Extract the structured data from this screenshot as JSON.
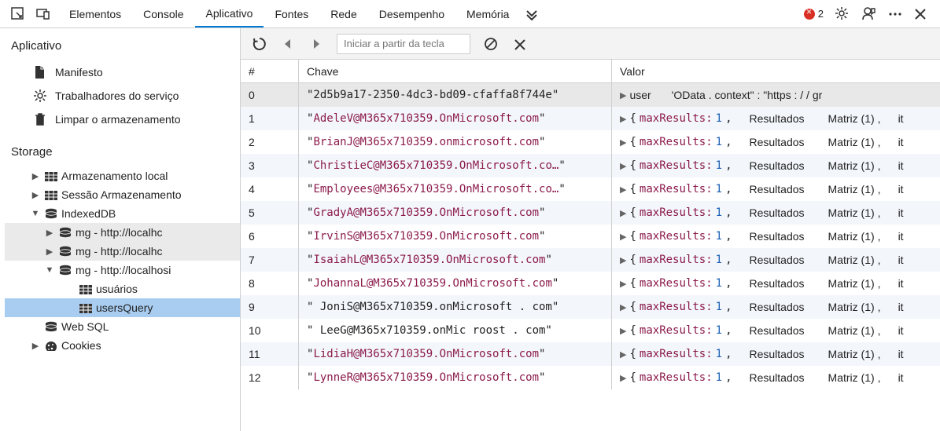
{
  "topbar": {
    "tabs": [
      "Elementos",
      "Console",
      "Aplicativo",
      "Fontes",
      "Rede",
      "Desempenho",
      "Memória"
    ],
    "active_index": 2,
    "error_count": "2"
  },
  "sidebar": {
    "section_app": "Aplicativo",
    "app_items": [
      {
        "icon": "file",
        "label": "Manifesto"
      },
      {
        "icon": "gear",
        "label": "Trabalhadores do serviço"
      },
      {
        "icon": "trash",
        "label": "Limpar o armazenamento"
      }
    ],
    "section_storage": "Storage",
    "storage_tree": [
      {
        "indent": 1,
        "twist": "▶",
        "icon": "table",
        "label": "Armazenamento local"
      },
      {
        "indent": 1,
        "twist": "▶",
        "icon": "table",
        "label": "Sessão Armazenamento"
      },
      {
        "indent": 1,
        "twist": "▼",
        "icon": "db",
        "label": "IndexedDB"
      },
      {
        "indent": 2,
        "twist": "▶",
        "icon": "db",
        "label": "mg - http://localhc",
        "shaded": true
      },
      {
        "indent": 2,
        "twist": "▶",
        "icon": "db",
        "label": "mg - http://localhc",
        "shaded": true
      },
      {
        "indent": 2,
        "twist": "▼",
        "icon": "db",
        "label": "mg - http://localhosi"
      },
      {
        "indent": 3,
        "twist": "",
        "icon": "table",
        "label": "usuários"
      },
      {
        "indent": 3,
        "twist": "",
        "icon": "table",
        "label": "usersQuery",
        "selected": true
      },
      {
        "indent": 1,
        "twist": "",
        "icon": "db",
        "label": "Web SQL"
      },
      {
        "indent": 1,
        "twist": "▶",
        "icon": "cookie",
        "label": "Cookies"
      }
    ]
  },
  "toolbar": {
    "filter_placeholder": "Iniciar a partir da tecla"
  },
  "table": {
    "headers": {
      "idx": "#",
      "key": "Chave",
      "val": "Valor"
    },
    "rows": [
      {
        "idx": "0",
        "key_plain": "\"2d5b9a17-2350-4dc3-bd09-cfaffa8f744e\"",
        "val_type": "header",
        "val_text_a": "user",
        "val_text_b": "'OData . context\" : \"https : / / gr"
      },
      {
        "idx": "1",
        "key_em": "AdeleV@M365x710359.OnMicrosoft.com",
        "val_type": "obj"
      },
      {
        "idx": "2",
        "key_em": "BrianJ@M365x710359.onmicrosoft.com",
        "val_type": "obj"
      },
      {
        "idx": "3",
        "key_em": "ChristieC@M365x710359.OnMicrosoft.co…",
        "val_type": "obj"
      },
      {
        "idx": "4",
        "key_em": "Employees@M365x710359.OnMicrosoft.co…",
        "val_type": "obj"
      },
      {
        "idx": "5",
        "key_em": "GradyA@M365x710359.OnMicrosoft.com",
        "val_type": "obj"
      },
      {
        "idx": "6",
        "key_em": "IrvinS@M365x710359.OnMicrosoft.com",
        "val_type": "obj"
      },
      {
        "idx": "7",
        "key_em": "IsaiahL@M365x710359.OnMicrosoft.com",
        "val_type": "obj"
      },
      {
        "idx": "8",
        "key_em": "JohannaL@M365x710359.OnMicrosoft.com",
        "val_type": "obj"
      },
      {
        "idx": "9",
        "key_plain": "\" JoniS@M365x710359.onMicrosoft . com\"",
        "val_type": "obj"
      },
      {
        "idx": "10",
        "key_plain": "\" LeeG@M365x710359.onMic roost . com\"",
        "val_type": "obj"
      },
      {
        "idx": "11",
        "key_em": "LidiaH@M365x710359.OnMicrosoft.com",
        "val_type": "obj"
      },
      {
        "idx": "12",
        "key_em": "LynneR@M365x710359.OnMicrosoft.com",
        "val_type": "obj"
      }
    ],
    "obj_value": {
      "prop": "maxResults:",
      "num": "1",
      "comma": ",",
      "res": "Resultados",
      "mat": "Matriz (1)",
      "mcomma": ",",
      "it": "it"
    }
  }
}
